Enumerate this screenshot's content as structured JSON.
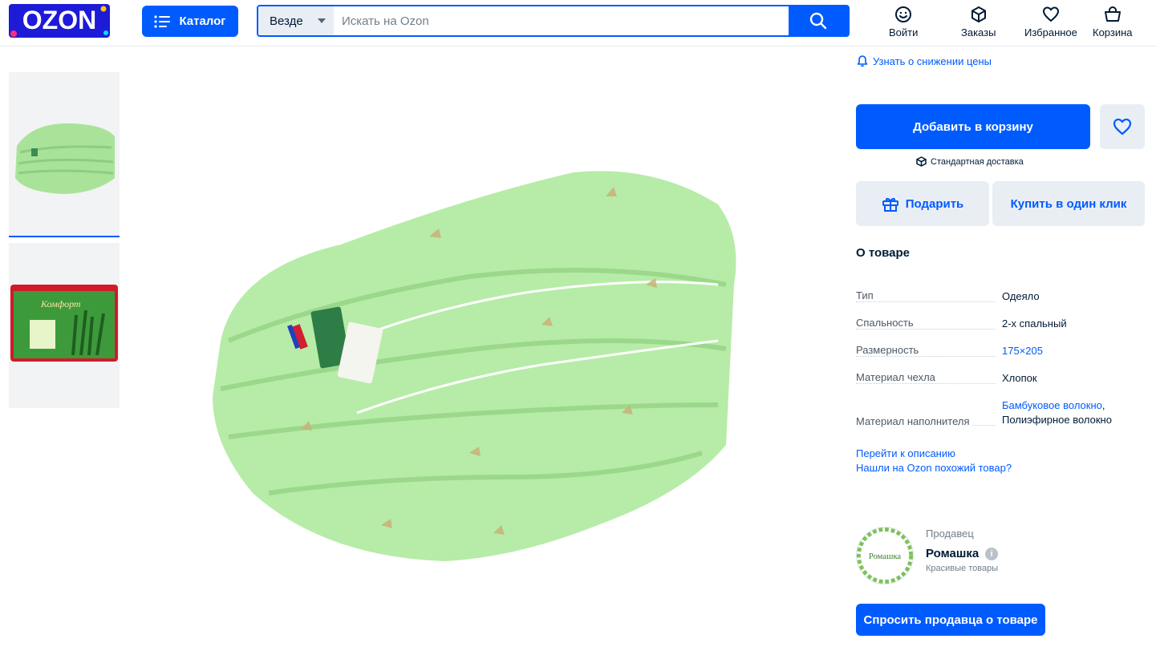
{
  "header": {
    "logo_text": "OZON",
    "catalog_label": "Каталог",
    "search_scope": "Везде",
    "search_placeholder": "Искать на Ozon",
    "nav": [
      {
        "label": "Войти",
        "icon": "user-icon"
      },
      {
        "label": "Заказы",
        "icon": "box-icon"
      },
      {
        "label": "Избранное",
        "icon": "heart-icon"
      },
      {
        "label": "Корзина",
        "icon": "basket-icon"
      }
    ]
  },
  "product": {
    "price_alert": "Узнать о снижении цены",
    "add_to_cart": "Добавить в корзину",
    "delivery": "Стандартная доставка",
    "gift": "Подарить",
    "one_click": "Купить в один клик",
    "about_title": "О товаре",
    "specs": [
      {
        "key": "Тип",
        "value": "Одеяло"
      },
      {
        "key": "Спальность",
        "value": "2-х спальный"
      },
      {
        "key": "Размерность",
        "value": "175×205"
      },
      {
        "key": "Материал чехла",
        "value": "Хлопок"
      },
      {
        "key": "Материал наполнителя",
        "value_link": "Бамбуковое волокно",
        "value_rest": ",",
        "value_line2": "Полиэфирное волокно"
      }
    ],
    "link_description": "Перейти к описанию",
    "link_similar": "Нашли на Ozon похожий товар?"
  },
  "seller": {
    "caption": "Продавец",
    "name": "Ромашка",
    "subtitle": "Красивые товары",
    "logo_text": "Ромашка",
    "ask_button": "Спросить продавца о товаре"
  },
  "package_label": "Комфорт",
  "colors": {
    "accent": "#005bff",
    "button_secondary": "#e9eef5",
    "text": "#001a34",
    "muted": "#707f8d"
  }
}
